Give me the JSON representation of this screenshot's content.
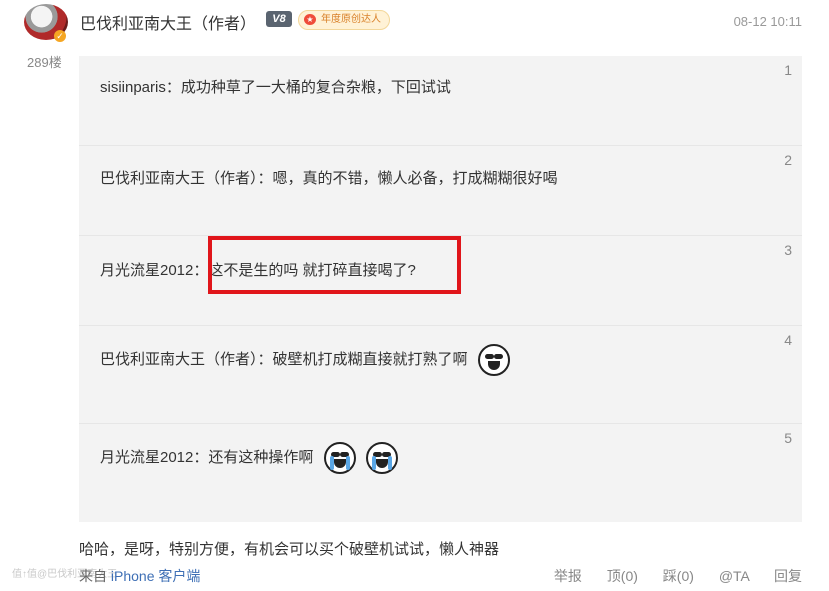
{
  "author": {
    "name": "巴伐利亚南大王（作者）",
    "vip_level": "V8",
    "badge_text": "年度原创达人",
    "avatar_badge": "✓",
    "floor": "289楼",
    "time": "08-12 10:11"
  },
  "replies": [
    {
      "index": "1",
      "user": "sisiinparis",
      "sep": "：",
      "text": "成功种草了一大桶的复合杂粮，下回试试",
      "emojis": []
    },
    {
      "index": "2",
      "user": "巴伐利亚南大王（作者）",
      "sep": "：",
      "text": "嗯，真的不错，懒人必备，打成糊糊很好喝",
      "emojis": []
    },
    {
      "index": "3",
      "user": "月光流星2012",
      "sep": "：",
      "text": "这不是生的吗 就打碎直接喝了?",
      "emojis": []
    },
    {
      "index": "4",
      "user": "巴伐利亚南大王（作者）",
      "sep": "：",
      "text": "破壁机打成糊直接就打熟了啊",
      "emojis": [
        "grin-emoji"
      ]
    },
    {
      "index": "5",
      "user": "月光流星2012",
      "sep": "：",
      "text": "还有这种操作啊",
      "emojis": [
        "laugh-cry-emoji",
        "laugh-cry-emoji"
      ]
    }
  ],
  "main_text": "哈哈，是呀，特别方便，有机会可以买个破壁机试试，懒人神器",
  "source": {
    "prefix": "来自",
    "client": "iPhone 客户端"
  },
  "watermark": "值↑值@巴伐利亚南大王",
  "actions": {
    "report": "举报",
    "like": "顶(0)",
    "dislike": "踩(0)",
    "mention": "@TA",
    "reply": "回复"
  },
  "colors": {
    "highlight": "#e0151a",
    "link": "#3e6fb5",
    "reply_bg": "#f3f3f3"
  }
}
